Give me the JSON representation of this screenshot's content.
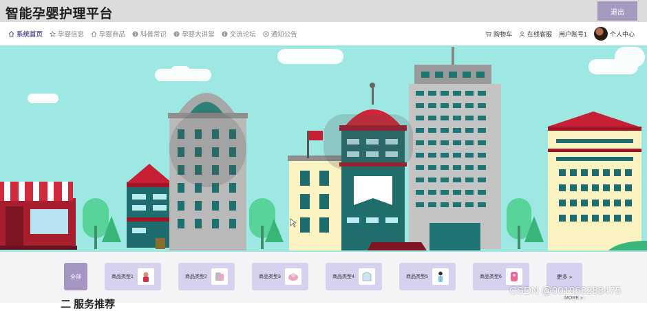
{
  "header": {
    "app_title": "智能孕婴护理平台",
    "logout_label": "退出"
  },
  "nav": {
    "items": [
      {
        "label": "系统首页",
        "icon": "home-icon",
        "active": true
      },
      {
        "label": "孕婴信息",
        "icon": "star-icon"
      },
      {
        "label": "孕婴商品",
        "icon": "home-outline-icon"
      },
      {
        "label": "科普常识",
        "icon": "info-icon"
      },
      {
        "label": "孕婴大讲堂",
        "icon": "question-icon"
      },
      {
        "label": "交流论坛",
        "icon": "info-icon"
      },
      {
        "label": "通知公告",
        "icon": "settings-icon"
      }
    ],
    "right": {
      "cart": "购物车",
      "service": "在线客服",
      "account": "用户账号1",
      "profile": "个人中心"
    }
  },
  "categories": {
    "all_label": "全部",
    "items": [
      "商品类型1",
      "商品类型2",
      "商品类型3",
      "商品类型4",
      "商品类型5",
      "商品类型6"
    ],
    "more_label": "更多 »"
  },
  "section_peek": "二 服务推荐",
  "more_link": "MORE »",
  "watermark": "CSDN @001963288475",
  "colors": {
    "accent": "#a699c0",
    "category_bg": "#d6d1ef",
    "banner_sky": "#9de8e3"
  }
}
